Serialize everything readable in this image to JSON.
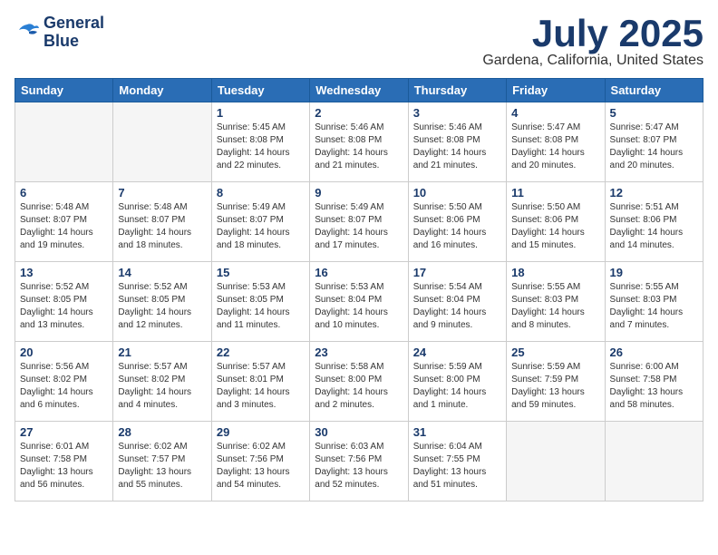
{
  "header": {
    "logo_line1": "General",
    "logo_line2": "Blue",
    "month_title": "July 2025",
    "location": "Gardena, California, United States"
  },
  "weekdays": [
    "Sunday",
    "Monday",
    "Tuesday",
    "Wednesday",
    "Thursday",
    "Friday",
    "Saturday"
  ],
  "weeks": [
    [
      {
        "day": "",
        "empty": true
      },
      {
        "day": "",
        "empty": true
      },
      {
        "day": "1",
        "sunrise": "Sunrise: 5:45 AM",
        "sunset": "Sunset: 8:08 PM",
        "daylight": "Daylight: 14 hours and 22 minutes."
      },
      {
        "day": "2",
        "sunrise": "Sunrise: 5:46 AM",
        "sunset": "Sunset: 8:08 PM",
        "daylight": "Daylight: 14 hours and 21 minutes."
      },
      {
        "day": "3",
        "sunrise": "Sunrise: 5:46 AM",
        "sunset": "Sunset: 8:08 PM",
        "daylight": "Daylight: 14 hours and 21 minutes."
      },
      {
        "day": "4",
        "sunrise": "Sunrise: 5:47 AM",
        "sunset": "Sunset: 8:08 PM",
        "daylight": "Daylight: 14 hours and 20 minutes."
      },
      {
        "day": "5",
        "sunrise": "Sunrise: 5:47 AM",
        "sunset": "Sunset: 8:07 PM",
        "daylight": "Daylight: 14 hours and 20 minutes."
      }
    ],
    [
      {
        "day": "6",
        "sunrise": "Sunrise: 5:48 AM",
        "sunset": "Sunset: 8:07 PM",
        "daylight": "Daylight: 14 hours and 19 minutes."
      },
      {
        "day": "7",
        "sunrise": "Sunrise: 5:48 AM",
        "sunset": "Sunset: 8:07 PM",
        "daylight": "Daylight: 14 hours and 18 minutes."
      },
      {
        "day": "8",
        "sunrise": "Sunrise: 5:49 AM",
        "sunset": "Sunset: 8:07 PM",
        "daylight": "Daylight: 14 hours and 18 minutes."
      },
      {
        "day": "9",
        "sunrise": "Sunrise: 5:49 AM",
        "sunset": "Sunset: 8:07 PM",
        "daylight": "Daylight: 14 hours and 17 minutes."
      },
      {
        "day": "10",
        "sunrise": "Sunrise: 5:50 AM",
        "sunset": "Sunset: 8:06 PM",
        "daylight": "Daylight: 14 hours and 16 minutes."
      },
      {
        "day": "11",
        "sunrise": "Sunrise: 5:50 AM",
        "sunset": "Sunset: 8:06 PM",
        "daylight": "Daylight: 14 hours and 15 minutes."
      },
      {
        "day": "12",
        "sunrise": "Sunrise: 5:51 AM",
        "sunset": "Sunset: 8:06 PM",
        "daylight": "Daylight: 14 hours and 14 minutes."
      }
    ],
    [
      {
        "day": "13",
        "sunrise": "Sunrise: 5:52 AM",
        "sunset": "Sunset: 8:05 PM",
        "daylight": "Daylight: 14 hours and 13 minutes."
      },
      {
        "day": "14",
        "sunrise": "Sunrise: 5:52 AM",
        "sunset": "Sunset: 8:05 PM",
        "daylight": "Daylight: 14 hours and 12 minutes."
      },
      {
        "day": "15",
        "sunrise": "Sunrise: 5:53 AM",
        "sunset": "Sunset: 8:05 PM",
        "daylight": "Daylight: 14 hours and 11 minutes."
      },
      {
        "day": "16",
        "sunrise": "Sunrise: 5:53 AM",
        "sunset": "Sunset: 8:04 PM",
        "daylight": "Daylight: 14 hours and 10 minutes."
      },
      {
        "day": "17",
        "sunrise": "Sunrise: 5:54 AM",
        "sunset": "Sunset: 8:04 PM",
        "daylight": "Daylight: 14 hours and 9 minutes."
      },
      {
        "day": "18",
        "sunrise": "Sunrise: 5:55 AM",
        "sunset": "Sunset: 8:03 PM",
        "daylight": "Daylight: 14 hours and 8 minutes."
      },
      {
        "day": "19",
        "sunrise": "Sunrise: 5:55 AM",
        "sunset": "Sunset: 8:03 PM",
        "daylight": "Daylight: 14 hours and 7 minutes."
      }
    ],
    [
      {
        "day": "20",
        "sunrise": "Sunrise: 5:56 AM",
        "sunset": "Sunset: 8:02 PM",
        "daylight": "Daylight: 14 hours and 6 minutes."
      },
      {
        "day": "21",
        "sunrise": "Sunrise: 5:57 AM",
        "sunset": "Sunset: 8:02 PM",
        "daylight": "Daylight: 14 hours and 4 minutes."
      },
      {
        "day": "22",
        "sunrise": "Sunrise: 5:57 AM",
        "sunset": "Sunset: 8:01 PM",
        "daylight": "Daylight: 14 hours and 3 minutes."
      },
      {
        "day": "23",
        "sunrise": "Sunrise: 5:58 AM",
        "sunset": "Sunset: 8:00 PM",
        "daylight": "Daylight: 14 hours and 2 minutes."
      },
      {
        "day": "24",
        "sunrise": "Sunrise: 5:59 AM",
        "sunset": "Sunset: 8:00 PM",
        "daylight": "Daylight: 14 hours and 1 minute."
      },
      {
        "day": "25",
        "sunrise": "Sunrise: 5:59 AM",
        "sunset": "Sunset: 7:59 PM",
        "daylight": "Daylight: 13 hours and 59 minutes."
      },
      {
        "day": "26",
        "sunrise": "Sunrise: 6:00 AM",
        "sunset": "Sunset: 7:58 PM",
        "daylight": "Daylight: 13 hours and 58 minutes."
      }
    ],
    [
      {
        "day": "27",
        "sunrise": "Sunrise: 6:01 AM",
        "sunset": "Sunset: 7:58 PM",
        "daylight": "Daylight: 13 hours and 56 minutes."
      },
      {
        "day": "28",
        "sunrise": "Sunrise: 6:02 AM",
        "sunset": "Sunset: 7:57 PM",
        "daylight": "Daylight: 13 hours and 55 minutes."
      },
      {
        "day": "29",
        "sunrise": "Sunrise: 6:02 AM",
        "sunset": "Sunset: 7:56 PM",
        "daylight": "Daylight: 13 hours and 54 minutes."
      },
      {
        "day": "30",
        "sunrise": "Sunrise: 6:03 AM",
        "sunset": "Sunset: 7:56 PM",
        "daylight": "Daylight: 13 hours and 52 minutes."
      },
      {
        "day": "31",
        "sunrise": "Sunrise: 6:04 AM",
        "sunset": "Sunset: 7:55 PM",
        "daylight": "Daylight: 13 hours and 51 minutes."
      },
      {
        "day": "",
        "empty": true
      },
      {
        "day": "",
        "empty": true
      }
    ]
  ]
}
